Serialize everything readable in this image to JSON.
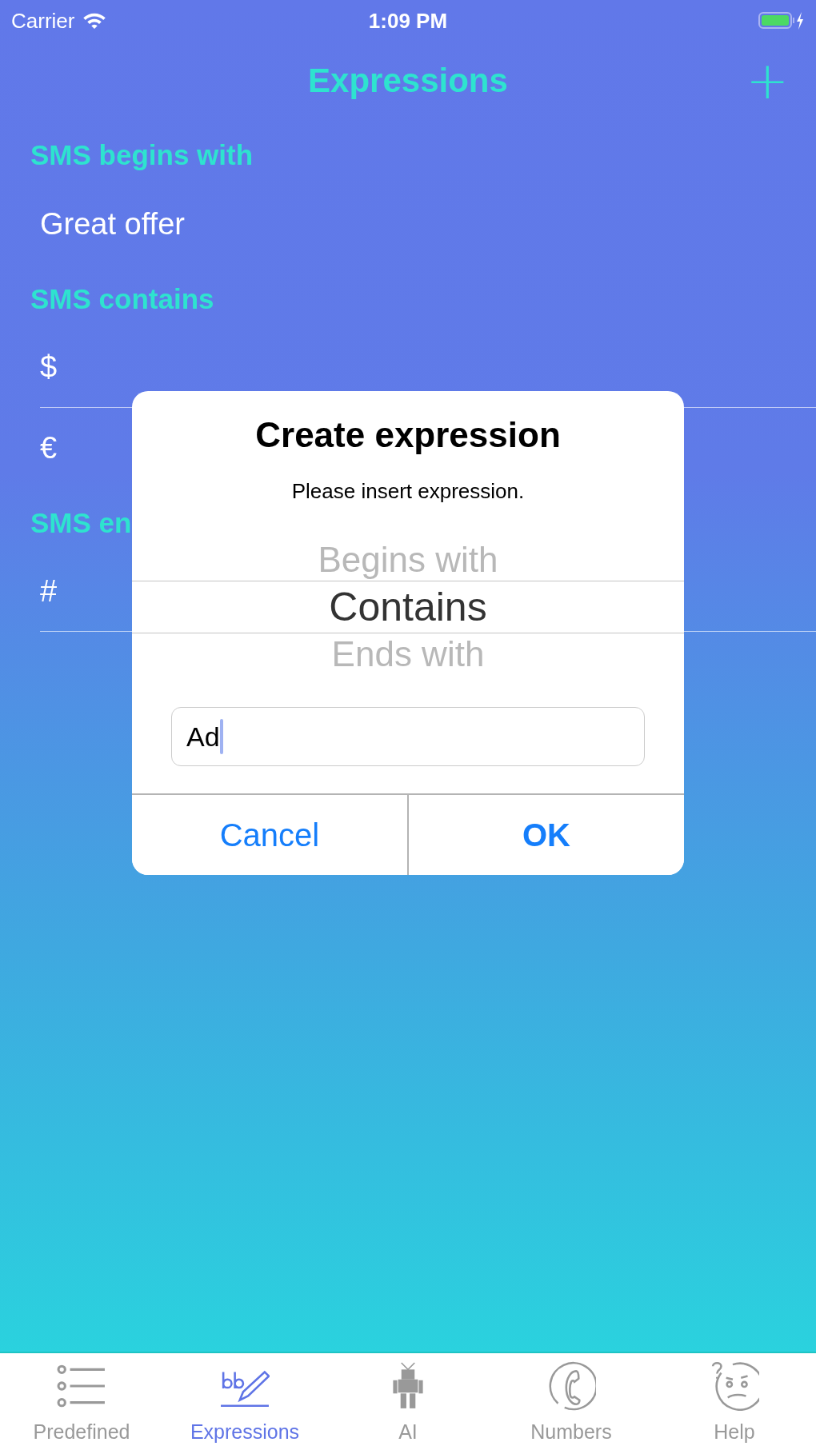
{
  "status_bar": {
    "carrier": "Carrier",
    "time": "1:09 PM"
  },
  "nav": {
    "title": "Expressions",
    "add_button": "+"
  },
  "sections": [
    {
      "header": "SMS begins with",
      "rows": [
        "Great offer"
      ]
    },
    {
      "header": "SMS contains",
      "rows": [
        "$",
        "€"
      ]
    },
    {
      "header": "SMS en",
      "rows": [
        "#"
      ]
    }
  ],
  "dialog": {
    "title": "Create expression",
    "message": "Please insert expression.",
    "picker": [
      {
        "label": "Begins with",
        "selected": false
      },
      {
        "label": "Contains",
        "selected": true
      },
      {
        "label": "Ends with",
        "selected": false
      }
    ],
    "field": {
      "value": "Ad"
    },
    "buttons": [
      {
        "label": "Cancel",
        "kind": "cancel"
      },
      {
        "label": "OK",
        "kind": "default"
      }
    ]
  },
  "tabs": [
    {
      "label": "Predefined",
      "kind": "list",
      "selected": false
    },
    {
      "label": "Expressions",
      "kind": "pen",
      "selected": true
    },
    {
      "label": "AI",
      "kind": "robot",
      "selected": false
    },
    {
      "label": "Numbers",
      "kind": "phone",
      "selected": false
    },
    {
      "label": "Help",
      "kind": "face",
      "selected": false
    }
  ]
}
